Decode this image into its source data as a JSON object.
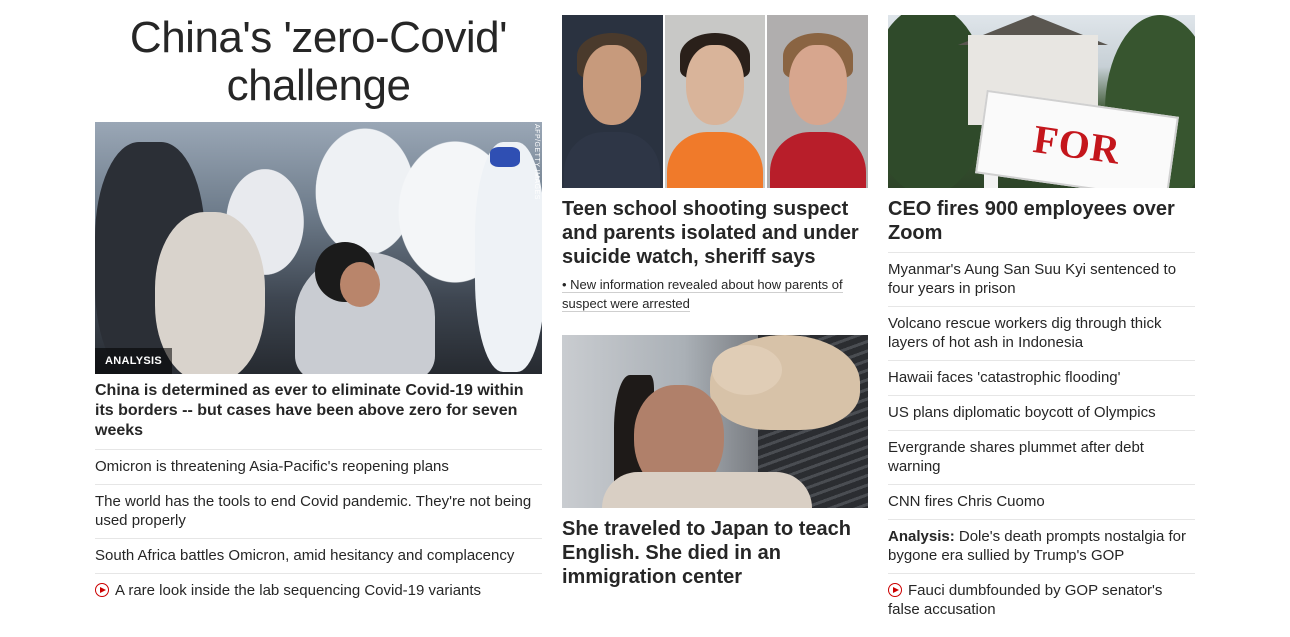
{
  "left": {
    "banner": "China's 'zero-Covid' challenge",
    "image_credit": "AFP/GETTY IMAGES",
    "image_tag": "ANALYSIS",
    "lead": "China is determined as ever to eliminate Covid-19 within its borders -- but cases have been above zero for seven weeks",
    "links": [
      "Omicron is threatening Asia-Pacific's reopening plans",
      "The world has the tools to end Covid pandemic. They're not being used properly",
      "South Africa battles Omicron, amid hesitancy and complacency"
    ],
    "video_link": "A rare look inside the lab sequencing Covid-19 variants"
  },
  "middle": {
    "headline1": "Teen school shooting suspect and parents isolated and under suicide watch, sheriff says",
    "sublink1": "• New information revealed about how parents of suspect were arrested",
    "headline2": "She traveled to Japan to teach English. She died in an immigration center"
  },
  "right": {
    "sign_text": "FOR SALE",
    "headline": "CEO fires 900 employees over Zoom",
    "links": [
      "Myanmar's Aung San Suu Kyi sentenced to four years in prison",
      "Volcano rescue workers dig through thick layers of hot ash in Indonesia",
      "Hawaii faces 'catastrophic flooding'",
      "US plans diplomatic boycott of Olympics",
      "Evergrande shares plummet after debt warning",
      "CNN fires Chris Cuomo"
    ],
    "analysis_label": "Analysis:",
    "analysis_text": " Dole's death prompts nostalgia for bygone era sullied by Trump's GOP",
    "video_link": "Fauci dumbfounded by GOP senator's false accusation"
  },
  "colors": {
    "text": "#262626",
    "divider": "#e6e6e6",
    "accent": "#cc0000"
  },
  "icons": {
    "video": "play-circle-icon"
  }
}
